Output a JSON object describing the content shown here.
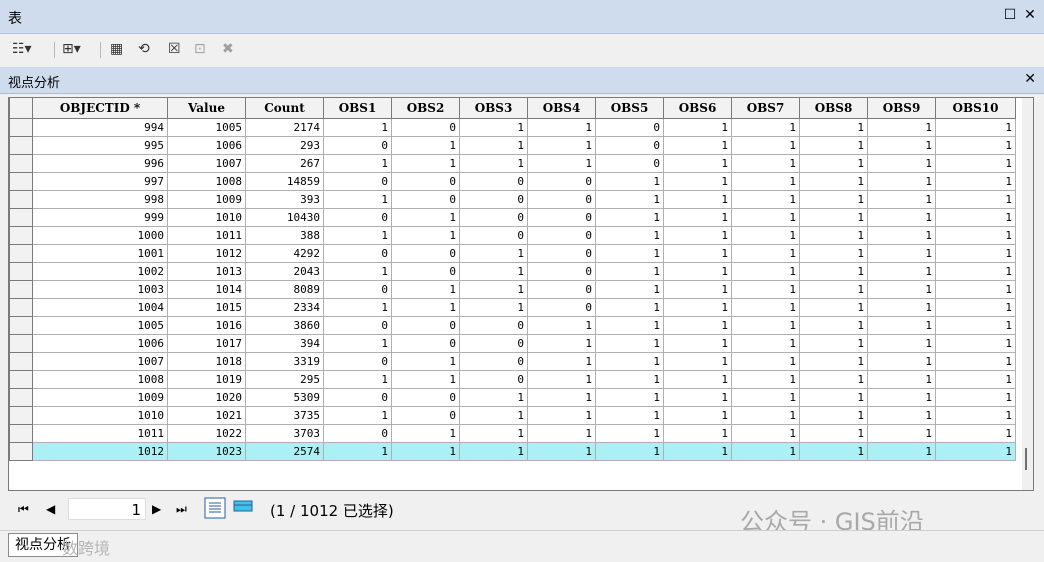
{
  "window": {
    "title": "表"
  },
  "tab": {
    "title": "视点分析"
  },
  "columns": [
    "OBJECTID *",
    "Value",
    "Count",
    "OBS1",
    "OBS2",
    "OBS3",
    "OBS4",
    "OBS5",
    "OBS6",
    "OBS7",
    "OBS8",
    "OBS9",
    "OBS10"
  ],
  "rows": [
    [
      "994",
      "1005",
      "2174",
      "1",
      "0",
      "1",
      "1",
      "0",
      "1",
      "1",
      "1",
      "1",
      "1"
    ],
    [
      "995",
      "1006",
      "293",
      "0",
      "1",
      "1",
      "1",
      "0",
      "1",
      "1",
      "1",
      "1",
      "1"
    ],
    [
      "996",
      "1007",
      "267",
      "1",
      "1",
      "1",
      "1",
      "0",
      "1",
      "1",
      "1",
      "1",
      "1"
    ],
    [
      "997",
      "1008",
      "14859",
      "0",
      "0",
      "0",
      "0",
      "1",
      "1",
      "1",
      "1",
      "1",
      "1"
    ],
    [
      "998",
      "1009",
      "393",
      "1",
      "0",
      "0",
      "0",
      "1",
      "1",
      "1",
      "1",
      "1",
      "1"
    ],
    [
      "999",
      "1010",
      "10430",
      "0",
      "1",
      "0",
      "0",
      "1",
      "1",
      "1",
      "1",
      "1",
      "1"
    ],
    [
      "1000",
      "1011",
      "388",
      "1",
      "1",
      "0",
      "0",
      "1",
      "1",
      "1",
      "1",
      "1",
      "1"
    ],
    [
      "1001",
      "1012",
      "4292",
      "0",
      "0",
      "1",
      "0",
      "1",
      "1",
      "1",
      "1",
      "1",
      "1"
    ],
    [
      "1002",
      "1013",
      "2043",
      "1",
      "0",
      "1",
      "0",
      "1",
      "1",
      "1",
      "1",
      "1",
      "1"
    ],
    [
      "1003",
      "1014",
      "8089",
      "0",
      "1",
      "1",
      "0",
      "1",
      "1",
      "1",
      "1",
      "1",
      "1"
    ],
    [
      "1004",
      "1015",
      "2334",
      "1",
      "1",
      "1",
      "0",
      "1",
      "1",
      "1",
      "1",
      "1",
      "1"
    ],
    [
      "1005",
      "1016",
      "3860",
      "0",
      "0",
      "0",
      "1",
      "1",
      "1",
      "1",
      "1",
      "1",
      "1"
    ],
    [
      "1006",
      "1017",
      "394",
      "1",
      "0",
      "0",
      "1",
      "1",
      "1",
      "1",
      "1",
      "1",
      "1"
    ],
    [
      "1007",
      "1018",
      "3319",
      "0",
      "1",
      "0",
      "1",
      "1",
      "1",
      "1",
      "1",
      "1",
      "1"
    ],
    [
      "1008",
      "1019",
      "295",
      "1",
      "1",
      "0",
      "1",
      "1",
      "1",
      "1",
      "1",
      "1",
      "1"
    ],
    [
      "1009",
      "1020",
      "5309",
      "0",
      "0",
      "1",
      "1",
      "1",
      "1",
      "1",
      "1",
      "1",
      "1"
    ],
    [
      "1010",
      "1021",
      "3735",
      "1",
      "0",
      "1",
      "1",
      "1",
      "1",
      "1",
      "1",
      "1",
      "1"
    ],
    [
      "1011",
      "1022",
      "3703",
      "0",
      "1",
      "1",
      "1",
      "1",
      "1",
      "1",
      "1",
      "1",
      "1"
    ],
    [
      "1012",
      "1023",
      "2574",
      "1",
      "1",
      "1",
      "1",
      "1",
      "1",
      "1",
      "1",
      "1",
      "1"
    ]
  ],
  "highlight_row": "1012",
  "nav": {
    "first": "⏮",
    "prev": "◀",
    "record": "1",
    "next": "▶",
    "last": "⏭",
    "status": "(1 / 1012 已选择)"
  },
  "bottom_tab": {
    "label": "视点分析"
  },
  "watermark": {
    "text": "公众号 · GIS前沿",
    "overlay": "数跨境"
  },
  "toolbar_icons": [
    "table-options-icon",
    "related-tables-icon",
    "select-by-attributes-icon",
    "switch-selection-icon",
    "clear-selection-icon",
    "zoom-to-selected-icon",
    "delete-selected-icon"
  ],
  "colors": {
    "title_bg": "#cfdcee",
    "highlight": "#aaf0f4"
  }
}
